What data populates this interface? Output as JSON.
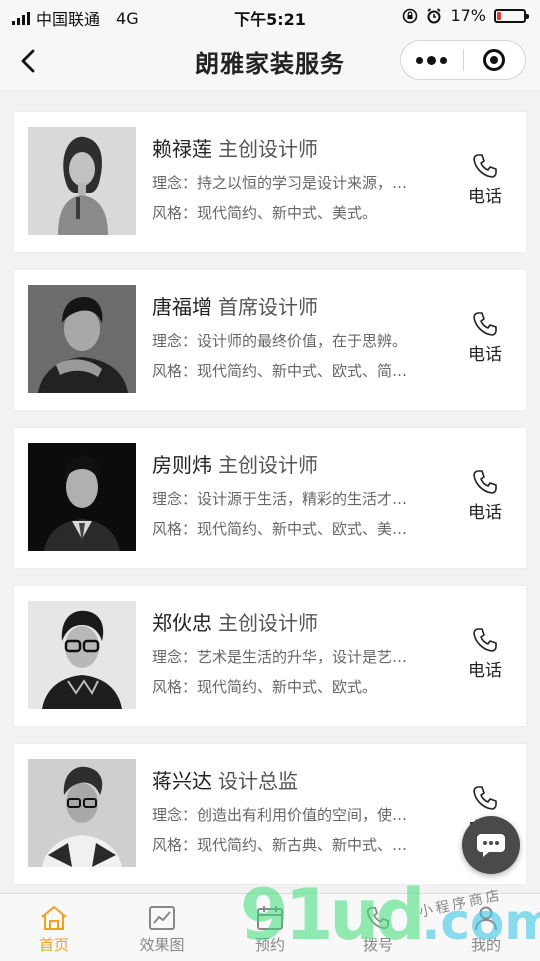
{
  "status_bar": {
    "carrier": "中国联通",
    "network": "4G",
    "time": "下午5:21",
    "battery_percent": "17%",
    "battery_level": 0.17
  },
  "nav": {
    "title": "朗雅家装服务"
  },
  "designers": [
    {
      "name": "赖禄莲",
      "title": "主创设计师",
      "philosophy": "理念：持之以恒的学习是设计来源，…",
      "style": "风格：现代简约、新中式、美式。",
      "call_label": "电话"
    },
    {
      "name": "唐福增",
      "title": "首席设计师",
      "philosophy": "理念：设计师的最终价值，在于思辨。",
      "style": "风格：现代简约、新中式、欧式、简…",
      "call_label": "电话"
    },
    {
      "name": "房则炜",
      "title": "主创设计师",
      "philosophy": "理念：设计源于生活，精彩的生活才…",
      "style": "风格：现代简约、新中式、欧式、美…",
      "call_label": "电话"
    },
    {
      "name": "郑伙忠",
      "title": "主创设计师",
      "philosophy": "理念：艺术是生活的升华，设计是艺…",
      "style": "风格：现代简约、新中式、欧式。",
      "call_label": "电话"
    },
    {
      "name": "蒋兴达",
      "title": "设计总监",
      "philosophy": "理念：创造出有利用价值的空间，使…",
      "style": "风格：现代简约、新古典、新中式、…",
      "call_label": "电话"
    }
  ],
  "tabs": [
    {
      "label": "首页",
      "icon": "home-icon",
      "active": true
    },
    {
      "label": "效果图",
      "icon": "chart-icon",
      "active": false
    },
    {
      "label": "预约",
      "icon": "calendar-icon",
      "active": false
    },
    {
      "label": "拨号",
      "icon": "phone-icon",
      "active": false
    },
    {
      "label": "我的",
      "icon": "user-icon",
      "active": false
    }
  ],
  "watermark": {
    "mark": "91ud",
    "domain": ".com",
    "caption": "小程序商店"
  },
  "colors": {
    "accent": "#f0a020",
    "tab_inactive": "#888888",
    "battery_low": "#e53935"
  }
}
